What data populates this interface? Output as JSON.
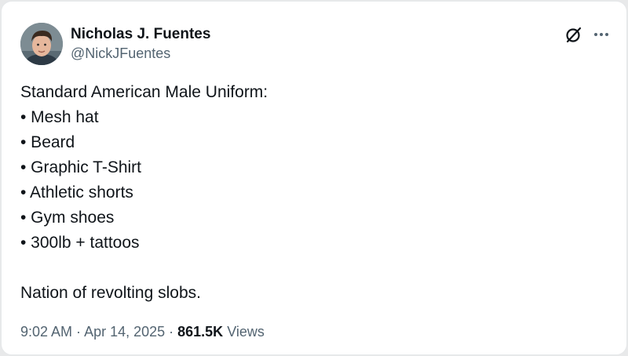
{
  "author": {
    "display_name": "Nicholas J. Fuentes",
    "handle": "@NickJFuentes"
  },
  "icons": {
    "grok": "grok-icon",
    "more": "more-options-icon"
  },
  "tweet": {
    "heading": "Standard American Male Uniform:",
    "items": [
      "• Mesh hat",
      "• Beard",
      "• Graphic T-Shirt",
      "• Athletic shorts",
      "• Gym shoes",
      "• 300lb + tattoos"
    ],
    "closing": "Nation of revolting slobs."
  },
  "meta": {
    "time": "9:02 AM",
    "separator": " · ",
    "date": "Apr 14, 2025",
    "views_count": "861.5K",
    "views_label": " Views"
  },
  "colors": {
    "text_primary": "#0f1419",
    "text_secondary": "#536471",
    "card_background": "#ffffff",
    "page_background": "#e8e9ea"
  }
}
